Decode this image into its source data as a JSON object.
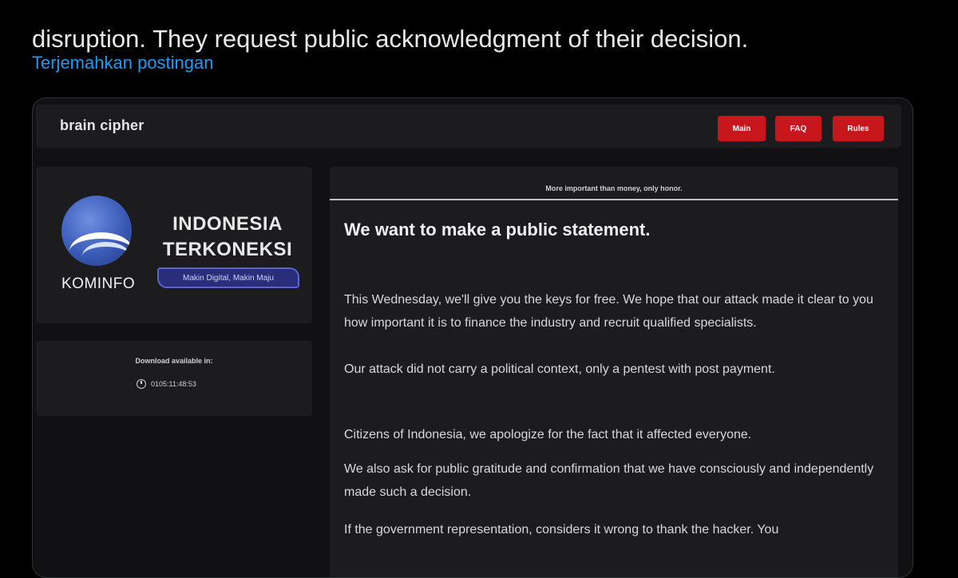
{
  "tweet": {
    "text_line": "disruption. They request public acknowledgment of their decision.",
    "translate_label": "Terjemahkan postingan"
  },
  "site": {
    "brand": "brain cipher",
    "nav": [
      {
        "label": "Main"
      },
      {
        "label": "FAQ"
      },
      {
        "label": "Rules"
      }
    ]
  },
  "victim": {
    "logo_text": "KOMINFO",
    "campaign_line1": "INDONESIA",
    "campaign_line2": "TERKONEKSI",
    "tagline": "Makin Digital, Makin Maju"
  },
  "download": {
    "label": "Download available in:",
    "timer": "0105:11:48:53"
  },
  "statement": {
    "motto": "More important than money, only honor.",
    "title": "We want to make a public statement.",
    "p1": "This Wednesday, we'll give you the keys for free. We hope that our attack made it clear to you how important it is to finance the industry and recruit qualified specialists.",
    "p2": "Our attack did not carry a political context, only a pentest with post payment.",
    "p3": "Citizens of Indonesia, we apologize for the fact that it affected everyone.",
    "p4": "We also ask for public gratitude and confirmation that we have consciously and independently made such a decision.",
    "p5": "If the government representation, considers it wrong to thank the hacker. You"
  },
  "colors": {
    "accent_red": "#c8161d",
    "link_blue": "#1d9bf0",
    "background": "#000000"
  }
}
